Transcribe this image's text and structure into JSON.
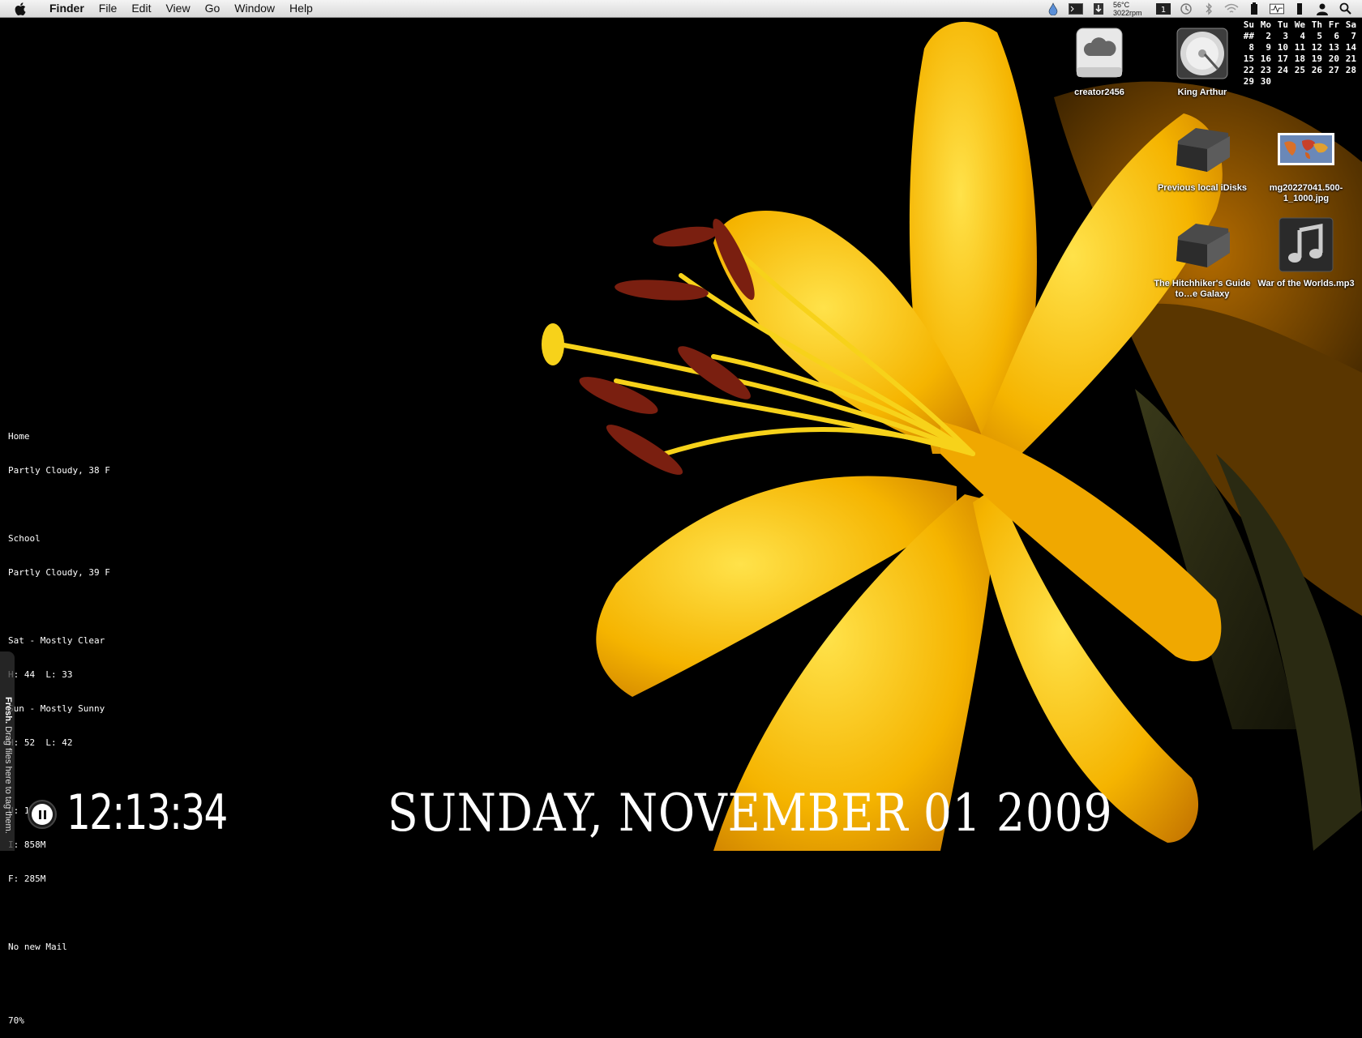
{
  "menubar": {
    "app_name": "Finder",
    "menus": [
      "File",
      "Edit",
      "View",
      "Go",
      "Window",
      "Help"
    ],
    "status": {
      "temperature": "56°C",
      "fan_speed": "3022rpm"
    }
  },
  "desktop_icons": {
    "creator": "creator2456",
    "king_arthur": "King Arthur",
    "previous_idisks": "Previous local iDisks",
    "image_file": "mg20227041.500-1_1000.jpg",
    "hitchhiker": "The Hitchhiker's Guide to…e Galaxy",
    "war_worlds": "War of the Worlds.mp3"
  },
  "calendar": {
    "headers": [
      "Su",
      "Mo",
      "Tu",
      "We",
      "Th",
      "Fr",
      "Sa"
    ],
    "weeks": [
      [
        "##",
        "2",
        "3",
        "4",
        "5",
        "6",
        "7"
      ],
      [
        "8",
        "9",
        "10",
        "11",
        "12",
        "13",
        "14"
      ],
      [
        "15",
        "16",
        "17",
        "18",
        "19",
        "20",
        "21"
      ],
      [
        "22",
        "23",
        "24",
        "25",
        "26",
        "27",
        "28"
      ],
      [
        "29",
        "30",
        "",
        "",
        "",
        "",
        ""
      ]
    ]
  },
  "geektool": {
    "home_label": "Home",
    "home_weather": "Partly Cloudy, 38 F",
    "school_label": "School",
    "school_weather": "Partly Cloudy, 39 F",
    "sat_forecast": "Sat - Mostly Clear",
    "sat_temps": "H: 44  L: 33",
    "sun_forecast": "Sun - Mostly Sunny",
    "sun_temps": "H: 52  L: 42",
    "mem_used": "U: 1761M",
    "mem_inactive": "I: 858M",
    "mem_free": "F: 285M",
    "mail": "No new Mail",
    "battery": "70%"
  },
  "fresh": {
    "brand": "Fresh.",
    "hint": " Drag files here to tag them."
  },
  "clock": {
    "time": "12:13:34",
    "date": "Sunday, November 01 2009"
  }
}
